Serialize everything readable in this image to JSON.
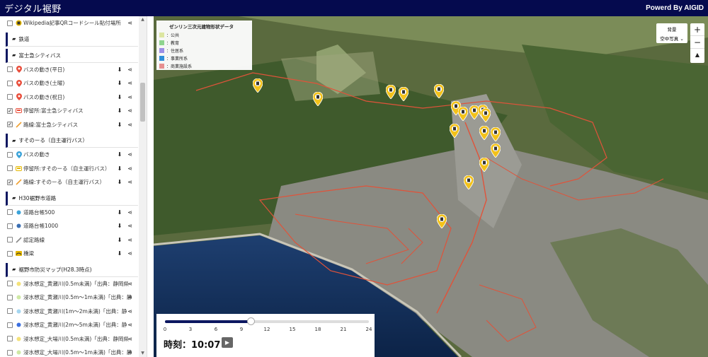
{
  "header": {
    "title": "デジタル裾野",
    "credit": "Powerd By AIGID"
  },
  "sidebar": {
    "rows": [
      {
        "kind": "item",
        "checked": false,
        "icon": "qr-pin-icon",
        "icon_color": "#e6b800",
        "label": "Wikipedia記事QRコードシール貼付場所",
        "actions": false,
        "share_only": true
      },
      {
        "kind": "group",
        "label": "鉄道"
      },
      {
        "kind": "group",
        "label": "富士急シティバス"
      },
      {
        "kind": "item",
        "checked": false,
        "icon": "map-pin-icon",
        "icon_color": "#e94e3b",
        "label": "バスの動き(平日)",
        "actions": true
      },
      {
        "kind": "item",
        "checked": false,
        "icon": "map-pin-icon",
        "icon_color": "#e94e3b",
        "label": "バスの動き(土曜)",
        "actions": true
      },
      {
        "kind": "item",
        "checked": false,
        "icon": "map-pin-icon",
        "icon_color": "#e94e3b",
        "label": "バスの動き(祝日)",
        "actions": true
      },
      {
        "kind": "item",
        "checked": true,
        "icon": "bus-stop-icon",
        "icon_color": "#e94e3b",
        "label": "停留所:富士急シティバス",
        "actions": true
      },
      {
        "kind": "item",
        "checked": true,
        "icon": "route-line-icon",
        "icon_color": "#f0a030",
        "label": "路線:富士急シティバス",
        "actions": true
      },
      {
        "kind": "group",
        "label": "すそのーる（自主運行バス）"
      },
      {
        "kind": "item",
        "checked": false,
        "icon": "map-pin-icon",
        "icon_color": "#3ba3d9",
        "label": "バスの動き",
        "actions": true
      },
      {
        "kind": "item",
        "checked": false,
        "icon": "bus-stop-icon",
        "icon_color": "#e6b800",
        "label": "停留所:すそのーる（自主運行バス）",
        "actions": true
      },
      {
        "kind": "item",
        "checked": true,
        "icon": "route-line-icon",
        "icon_color": "#f0a030",
        "label": "路線:すそのーる（自主運行バス）",
        "actions": true
      },
      {
        "kind": "group",
        "label": "H30裾野市道路"
      },
      {
        "kind": "item",
        "checked": false,
        "icon": "dot-icon",
        "icon_color": "#3ba3d9",
        "label": "道路台帳500",
        "actions": true
      },
      {
        "kind": "item",
        "checked": false,
        "icon": "dot-icon",
        "icon_color": "#3b6fb3",
        "label": "道路台帳1000",
        "actions": true
      },
      {
        "kind": "item",
        "checked": false,
        "icon": "line-icon",
        "icon_color": "#888888",
        "label": "認定路線",
        "actions": true
      },
      {
        "kind": "item",
        "checked": false,
        "icon": "bridge-icon",
        "icon_color": "#e6b800",
        "label": "橋梁",
        "actions": true
      },
      {
        "kind": "group",
        "label": "裾野市防災マップ(H28.3時点)"
      },
      {
        "kind": "item",
        "checked": false,
        "icon": "dot-icon",
        "icon_color": "#f4e27a",
        "label": "浸水想定_黄瀬川(0.5m未満)「出典：静岡県",
        "actions": false,
        "share_only": true
      },
      {
        "kind": "item",
        "checked": false,
        "icon": "dot-icon",
        "icon_color": "#cfe9a5",
        "label": "浸水想定_黄瀬川(0.5m〜1m未満)「出典：静",
        "actions": false,
        "share_only": true
      },
      {
        "kind": "item",
        "checked": false,
        "icon": "dot-icon",
        "icon_color": "#a5d6f0",
        "label": "浸水想定_黄瀬川(1m〜2m未満)「出典：静",
        "actions": false,
        "share_only": true
      },
      {
        "kind": "item",
        "checked": false,
        "icon": "dot-icon",
        "icon_color": "#3b6fe0",
        "label": "浸水想定_黄瀬川(2m〜5m未満)「出典：静",
        "actions": false,
        "share_only": true
      },
      {
        "kind": "item",
        "checked": false,
        "icon": "dot-icon",
        "icon_color": "#f4e27a",
        "label": "浸水想定_大場川(0.5m未満)「出典：静岡県",
        "actions": false,
        "share_only": true
      },
      {
        "kind": "item",
        "checked": false,
        "icon": "dot-icon",
        "icon_color": "#cfe9a5",
        "label": "浸水想定_大場川(0.5m〜1m未満)「出典：静",
        "actions": false,
        "share_only": true
      }
    ]
  },
  "legend": {
    "title": "ゼンリン三次元建物形状データ",
    "items": [
      {
        "label": "：公共",
        "color": "#dce6a0"
      },
      {
        "label": "：教育",
        "color": "#8fd48f"
      },
      {
        "label": "：住居系",
        "color": "#9c8fe6"
      },
      {
        "label": "：事業所系",
        "color": "#2f8fd9"
      },
      {
        "label": "：商業施設系",
        "color": "#e68f8f"
      }
    ]
  },
  "basemap": {
    "label": "背景",
    "value": "空中写真"
  },
  "zoom": {
    "in": "+",
    "out": "−",
    "compass": "▲"
  },
  "timeline": {
    "ticks": [
      "0",
      "3",
      "6",
      "9",
      "12",
      "15",
      "18",
      "21",
      "24"
    ],
    "min": 0,
    "max": 24,
    "value": 10.12,
    "time_label": "時刻：10:07",
    "play": "▶"
  },
  "colors": {
    "header": "#050a4e",
    "accent": "#0c1760",
    "pin": "#f3c21a",
    "route": "#e0533a"
  }
}
